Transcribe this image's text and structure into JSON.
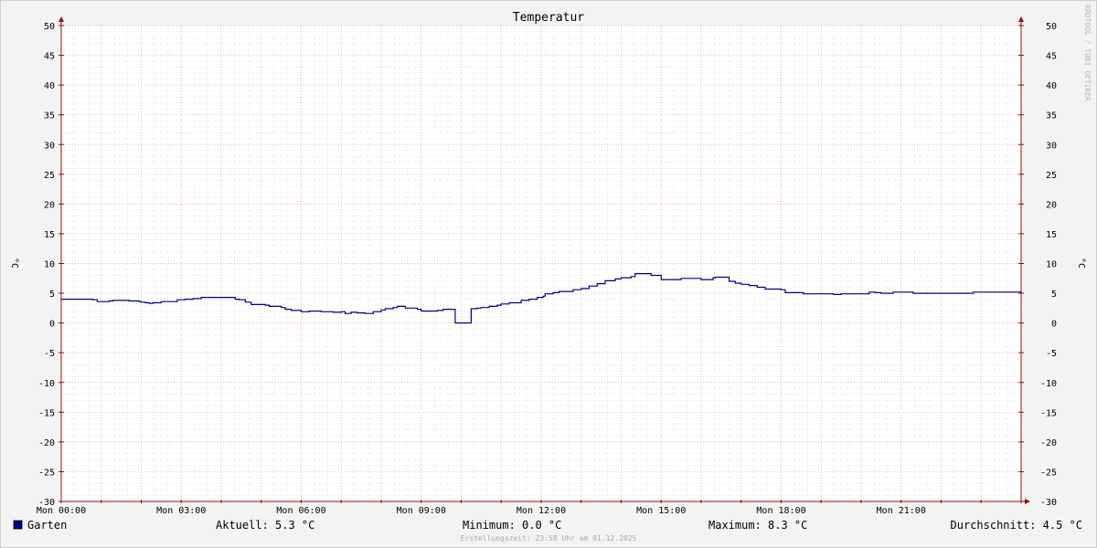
{
  "chart_data": {
    "type": "line",
    "title": "Temperatur",
    "ylabel": "°C",
    "ylabel_right": "°C",
    "ylim": [
      -30,
      50
    ],
    "yticks": [
      50,
      45,
      40,
      35,
      30,
      25,
      20,
      15,
      10,
      5,
      0,
      -5,
      -10,
      -15,
      -20,
      -25,
      -30
    ],
    "xlim": [
      0,
      24
    ],
    "xticks": [
      {
        "x": 0,
        "label": "Mon 00:00"
      },
      {
        "x": 3,
        "label": "Mon 03:00"
      },
      {
        "x": 6,
        "label": "Mon 06:00"
      },
      {
        "x": 9,
        "label": "Mon 09:00"
      },
      {
        "x": 12,
        "label": "Mon 12:00"
      },
      {
        "x": 15,
        "label": "Mon 15:00"
      },
      {
        "x": 18,
        "label": "Mon 18:00"
      },
      {
        "x": 21,
        "label": "Mon 21:00"
      }
    ],
    "grid": true,
    "legend_position": "bottom-left",
    "series": [
      {
        "name": "Garten",
        "color": "#000080",
        "points": [
          [
            0.0,
            4.0
          ],
          [
            0.7,
            4.0
          ],
          [
            0.8,
            3.9
          ],
          [
            0.85,
            3.9
          ],
          [
            0.9,
            3.6
          ],
          [
            1.2,
            3.7
          ],
          [
            1.3,
            3.8
          ],
          [
            1.6,
            3.8
          ],
          [
            1.7,
            3.7
          ],
          [
            1.95,
            3.6
          ],
          [
            2.0,
            3.5
          ],
          [
            2.1,
            3.4
          ],
          [
            2.2,
            3.3
          ],
          [
            2.3,
            3.4
          ],
          [
            2.5,
            3.6
          ],
          [
            2.9,
            3.9
          ],
          [
            3.1,
            4.0
          ],
          [
            3.3,
            4.1
          ],
          [
            3.5,
            4.3
          ],
          [
            4.0,
            4.3
          ],
          [
            4.3,
            4.3
          ],
          [
            4.35,
            4.0
          ],
          [
            4.45,
            3.9
          ],
          [
            4.6,
            3.5
          ],
          [
            4.75,
            3.1
          ],
          [
            5.1,
            3.0
          ],
          [
            5.2,
            2.8
          ],
          [
            5.4,
            2.8
          ],
          [
            5.5,
            2.6
          ],
          [
            5.6,
            2.3
          ],
          [
            5.75,
            2.1
          ],
          [
            6.0,
            1.9
          ],
          [
            6.2,
            2.0
          ],
          [
            6.5,
            1.9
          ],
          [
            6.8,
            1.8
          ],
          [
            7.0,
            1.9
          ],
          [
            7.1,
            1.6
          ],
          [
            7.25,
            1.8
          ],
          [
            7.4,
            1.7
          ],
          [
            7.6,
            1.6
          ],
          [
            7.8,
            1.9
          ],
          [
            8.0,
            2.2
          ],
          [
            8.1,
            2.4
          ],
          [
            8.3,
            2.6
          ],
          [
            8.4,
            2.8
          ],
          [
            8.5,
            2.8
          ],
          [
            8.6,
            2.5
          ],
          [
            8.8,
            2.5
          ],
          [
            8.9,
            2.3
          ],
          [
            9.0,
            2.0
          ],
          [
            9.2,
            2.0
          ],
          [
            9.4,
            2.1
          ],
          [
            9.55,
            2.3
          ],
          [
            9.8,
            2.3
          ],
          [
            9.85,
            0.0
          ],
          [
            10.2,
            0.0
          ],
          [
            10.25,
            2.4
          ],
          [
            10.4,
            2.5
          ],
          [
            10.5,
            2.6
          ],
          [
            10.7,
            2.8
          ],
          [
            10.9,
            3.0
          ],
          [
            11.0,
            3.2
          ],
          [
            11.2,
            3.4
          ],
          [
            11.4,
            3.4
          ],
          [
            11.5,
            3.8
          ],
          [
            11.7,
            4.0
          ],
          [
            11.9,
            4.3
          ],
          [
            12.05,
            4.5
          ],
          [
            12.1,
            4.9
          ],
          [
            12.3,
            5.1
          ],
          [
            12.45,
            5.3
          ],
          [
            12.8,
            5.6
          ],
          [
            13.0,
            5.8
          ],
          [
            13.2,
            6.2
          ],
          [
            13.4,
            6.6
          ],
          [
            13.6,
            7.1
          ],
          [
            13.85,
            7.4
          ],
          [
            14.0,
            7.6
          ],
          [
            14.25,
            7.8
          ],
          [
            14.35,
            8.3
          ],
          [
            14.7,
            8.3
          ],
          [
            14.75,
            8.0
          ],
          [
            14.9,
            8.0
          ],
          [
            15.0,
            7.3
          ],
          [
            15.3,
            7.3
          ],
          [
            15.5,
            7.5
          ],
          [
            15.8,
            7.5
          ],
          [
            16.0,
            7.3
          ],
          [
            16.3,
            7.6
          ],
          [
            16.35,
            7.7
          ],
          [
            16.6,
            7.7
          ],
          [
            16.7,
            7.0
          ],
          [
            16.85,
            6.7
          ],
          [
            17.0,
            6.5
          ],
          [
            17.2,
            6.3
          ],
          [
            17.4,
            6.0
          ],
          [
            17.6,
            5.7
          ],
          [
            17.8,
            5.7
          ],
          [
            18.0,
            5.6
          ],
          [
            18.1,
            5.1
          ],
          [
            18.4,
            5.1
          ],
          [
            18.55,
            4.9
          ],
          [
            19.0,
            4.9
          ],
          [
            19.3,
            4.8
          ],
          [
            19.5,
            4.9
          ],
          [
            19.8,
            4.9
          ],
          [
            20.0,
            4.9
          ],
          [
            20.2,
            5.2
          ],
          [
            20.35,
            5.1
          ],
          [
            20.5,
            5.0
          ],
          [
            20.8,
            5.2
          ],
          [
            21.0,
            5.2
          ],
          [
            21.3,
            5.0
          ],
          [
            22.0,
            5.0
          ],
          [
            22.5,
            5.0
          ],
          [
            22.8,
            5.2
          ],
          [
            23.5,
            5.2
          ],
          [
            24.0,
            5.3
          ]
        ]
      }
    ],
    "legend": [
      {
        "series": "Garten",
        "color": "#000080"
      }
    ],
    "stats": {
      "current": "Aktuell: 5.3 °C",
      "minimum": "Minimum: 0.0 °C",
      "maximum": "Maximum: 8.3 °C",
      "average": "Durchschnitt: 4.5 °C"
    },
    "footer": "Erstellungszeit: 23:58 Uhr am 01.12.2025",
    "watermark": "RRDTOOL / TOBI OETIKER"
  },
  "colors": {
    "background": "#f3f3f3",
    "plot_background": "#ffffff",
    "grid_minor": "#d0d0d0",
    "grid_major": "#e8a0a0",
    "axis": "#901010",
    "line": "#000080"
  }
}
